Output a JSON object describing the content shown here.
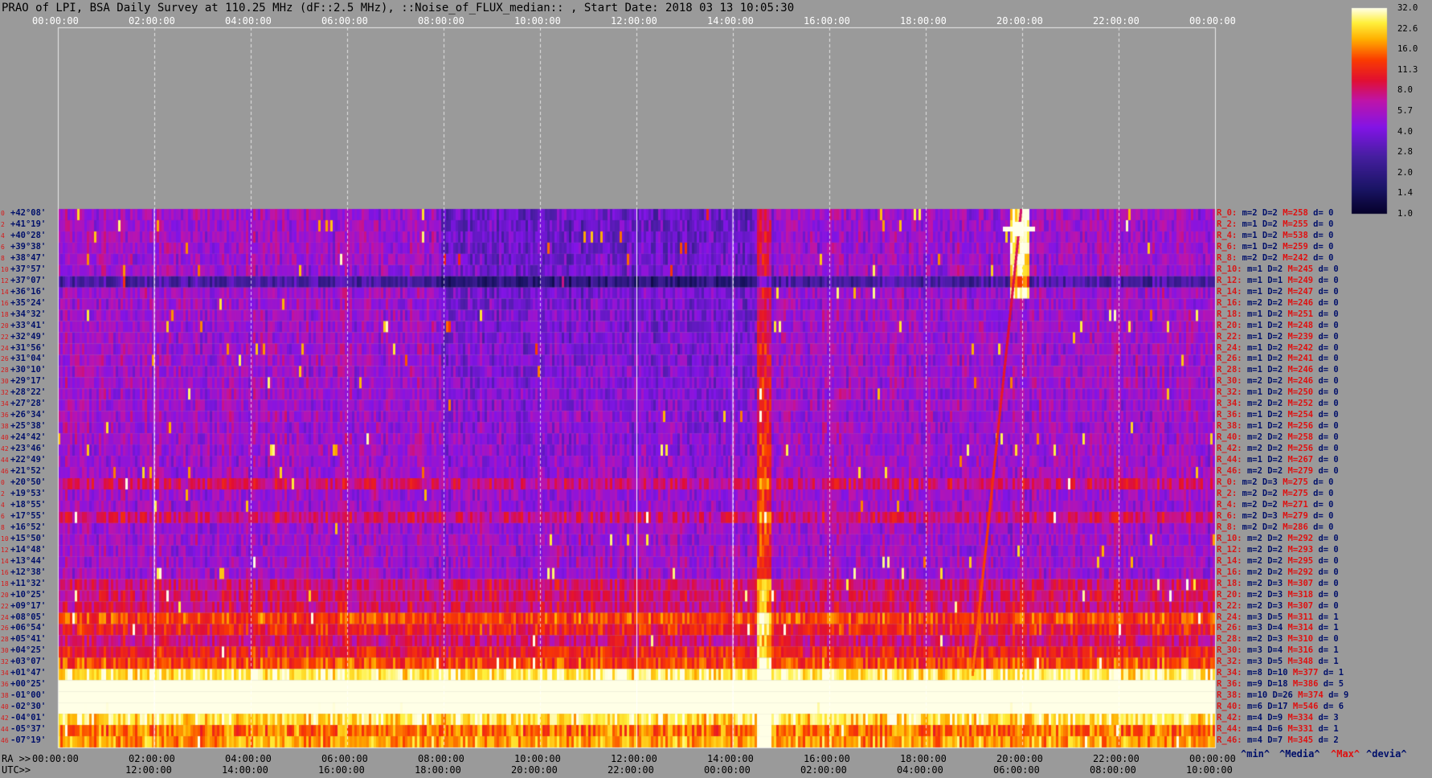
{
  "title": "PRAO of LPI, BSA Daily Survey at 110.25 MHz (dF::2.5 MHz), ::Noise_of_FLUX_median:: , Start Date: 2018 03 13 10:05:30",
  "top_axis": [
    "00:00:00",
    "02:00:00",
    "04:00:00",
    "06:00:00",
    "08:00:00",
    "10:00:00",
    "12:00:00",
    "14:00:00",
    "16:00:00",
    "18:00:00",
    "20:00:00",
    "22:00:00",
    "00:00:00"
  ],
  "bottom": {
    "ra_prefix": "RA >>",
    "ra_ticks": [
      "00:00:00",
      "02:00:00",
      "04:00:00",
      "06:00:00",
      "08:00:00",
      "10:00:00",
      "12:00:00",
      "14:00:00",
      "16:00:00",
      "18:00:00",
      "20:00:00",
      "22:00:00",
      "00:00:00"
    ],
    "utc_prefix": "UTC>>",
    "utc_ticks": [
      "12:00:00",
      "14:00:00",
      "16:00:00",
      "18:00:00",
      "20:00:00",
      "22:00:00",
      "00:00:00",
      "02:00:00",
      "04:00:00",
      "06:00:00",
      "08:00:00",
      "10:00:00"
    ],
    "legend": [
      "^min^",
      "^Media^",
      "^Max^",
      "^devia^"
    ]
  },
  "colorbar": {
    "ticks": [
      "32.0",
      "22.6",
      "16.0",
      "11.3",
      "8.0",
      "5.7",
      "4.0",
      "2.8",
      "2.0",
      "1.4",
      "1.0"
    ]
  },
  "colors": {
    "background": "#9a9a9a",
    "row_label_red": "#d81818",
    "row_label_blue": "#00106a"
  },
  "chart_data": {
    "type": "heatmap",
    "title": "PRAO of LPI, BSA Daily Survey at 110.25 MHz (dF::2.5 MHz), ::Noise_of_FLUX_median:: , Start Date: 2018 03 13 10:05:30",
    "x_axis_top": "RA 00:00:00 - 00:00:00",
    "colorscale_range": [
      1.0,
      32.0
    ],
    "scale": "log",
    "rows": [
      {
        "idx": "0",
        "dec": "+42°08'",
        "ch": "R_0:",
        "min": 2,
        "med": 2,
        "max": 258,
        "dev": 0
      },
      {
        "idx": "2",
        "dec": "+41°19'",
        "ch": "R_2:",
        "min": 1,
        "med": 2,
        "max": 255,
        "dev": 0
      },
      {
        "idx": "4",
        "dec": "+40°28'",
        "ch": "R_4:",
        "min": 1,
        "med": 2,
        "max": 538,
        "dev": 0
      },
      {
        "idx": "6",
        "dec": "+39°38'",
        "ch": "R_6:",
        "min": 1,
        "med": 2,
        "max": 259,
        "dev": 0
      },
      {
        "idx": "8",
        "dec": "+38°47'",
        "ch": "R_8:",
        "min": 2,
        "med": 2,
        "max": 242,
        "dev": 0
      },
      {
        "idx": "10",
        "dec": "+37°57'",
        "ch": "R_10:",
        "min": 1,
        "med": 2,
        "max": 245,
        "dev": 0
      },
      {
        "idx": "12",
        "dec": "+37°07'",
        "ch": "R_12:",
        "min": 1,
        "med": 1,
        "max": 249,
        "dev": 0
      },
      {
        "idx": "14",
        "dec": "+36°16'",
        "ch": "R_14:",
        "min": 1,
        "med": 2,
        "max": 247,
        "dev": 0
      },
      {
        "idx": "16",
        "dec": "+35°24'",
        "ch": "R_16:",
        "min": 2,
        "med": 2,
        "max": 246,
        "dev": 0
      },
      {
        "idx": "18",
        "dec": "+34°32'",
        "ch": "R_18:",
        "min": 1,
        "med": 2,
        "max": 251,
        "dev": 0
      },
      {
        "idx": "20",
        "dec": "+33°41'",
        "ch": "R_20:",
        "min": 1,
        "med": 2,
        "max": 248,
        "dev": 0
      },
      {
        "idx": "22",
        "dec": "+32°49'",
        "ch": "R_22:",
        "min": 1,
        "med": 2,
        "max": 239,
        "dev": 0
      },
      {
        "idx": "24",
        "dec": "+31°56'",
        "ch": "R_24:",
        "min": 1,
        "med": 2,
        "max": 242,
        "dev": 0
      },
      {
        "idx": "26",
        "dec": "+31°04'",
        "ch": "R_26:",
        "min": 1,
        "med": 2,
        "max": 241,
        "dev": 0
      },
      {
        "idx": "28",
        "dec": "+30°10'",
        "ch": "R_28:",
        "min": 1,
        "med": 2,
        "max": 246,
        "dev": 0
      },
      {
        "idx": "30",
        "dec": "+29°17'",
        "ch": "R_30:",
        "min": 2,
        "med": 2,
        "max": 246,
        "dev": 0
      },
      {
        "idx": "32",
        "dec": "+28°22'",
        "ch": "R_32:",
        "min": 1,
        "med": 2,
        "max": 250,
        "dev": 0
      },
      {
        "idx": "34",
        "dec": "+27°28'",
        "ch": "R_34:",
        "min": 2,
        "med": 2,
        "max": 252,
        "dev": 0
      },
      {
        "idx": "36",
        "dec": "+26°34'",
        "ch": "R_36:",
        "min": 1,
        "med": 2,
        "max": 254,
        "dev": 0
      },
      {
        "idx": "38",
        "dec": "+25°38'",
        "ch": "R_38:",
        "min": 1,
        "med": 2,
        "max": 256,
        "dev": 0
      },
      {
        "idx": "40",
        "dec": "+24°42'",
        "ch": "R_40:",
        "min": 2,
        "med": 2,
        "max": 258,
        "dev": 0
      },
      {
        "idx": "42",
        "dec": "+23°46'",
        "ch": "R_42:",
        "min": 2,
        "med": 2,
        "max": 256,
        "dev": 0
      },
      {
        "idx": "44",
        "dec": "+22°49'",
        "ch": "R_44:",
        "min": 1,
        "med": 2,
        "max": 267,
        "dev": 0
      },
      {
        "idx": "46",
        "dec": "+21°52'",
        "ch": "R_46:",
        "min": 2,
        "med": 2,
        "max": 279,
        "dev": 0
      },
      {
        "idx": "0",
        "dec": "+20°50'",
        "ch": "R_0:",
        "min": 2,
        "med": 3,
        "max": 275,
        "dev": 0
      },
      {
        "idx": "2",
        "dec": "+19°53'",
        "ch": "R_2:",
        "min": 2,
        "med": 2,
        "max": 275,
        "dev": 0
      },
      {
        "idx": "4",
        "dec": "+18°55'",
        "ch": "R_4:",
        "min": 2,
        "med": 2,
        "max": 271,
        "dev": 0
      },
      {
        "idx": "6",
        "dec": "+17°55'",
        "ch": "R_6:",
        "min": 2,
        "med": 3,
        "max": 279,
        "dev": 0
      },
      {
        "idx": "8",
        "dec": "+16°52'",
        "ch": "R_8:",
        "min": 2,
        "med": 2,
        "max": 286,
        "dev": 0
      },
      {
        "idx": "10",
        "dec": "+15°50'",
        "ch": "R_10:",
        "min": 2,
        "med": 2,
        "max": 292,
        "dev": 0
      },
      {
        "idx": "12",
        "dec": "+14°48'",
        "ch": "R_12:",
        "min": 2,
        "med": 2,
        "max": 293,
        "dev": 0
      },
      {
        "idx": "14",
        "dec": "+13°44'",
        "ch": "R_14:",
        "min": 2,
        "med": 2,
        "max": 295,
        "dev": 0
      },
      {
        "idx": "16",
        "dec": "+12°38'",
        "ch": "R_16:",
        "min": 2,
        "med": 2,
        "max": 292,
        "dev": 0
      },
      {
        "idx": "18",
        "dec": "+11°32'",
        "ch": "R_18:",
        "min": 2,
        "med": 3,
        "max": 307,
        "dev": 0
      },
      {
        "idx": "20",
        "dec": "+10°25'",
        "ch": "R_20:",
        "min": 2,
        "med": 3,
        "max": 318,
        "dev": 0
      },
      {
        "idx": "22",
        "dec": "+09°17'",
        "ch": "R_22:",
        "min": 2,
        "med": 3,
        "max": 307,
        "dev": 0
      },
      {
        "idx": "24",
        "dec": "+08°05'",
        "ch": "R_24:",
        "min": 3,
        "med": 5,
        "max": 311,
        "dev": 1
      },
      {
        "idx": "26",
        "dec": "+06°54'",
        "ch": "R_26:",
        "min": 3,
        "med": 4,
        "max": 314,
        "dev": 1
      },
      {
        "idx": "28",
        "dec": "+05°41'",
        "ch": "R_28:",
        "min": 2,
        "med": 3,
        "max": 310,
        "dev": 0
      },
      {
        "idx": "30",
        "dec": "+04°25'",
        "ch": "R_30:",
        "min": 3,
        "med": 4,
        "max": 316,
        "dev": 1
      },
      {
        "idx": "32",
        "dec": "+03°07'",
        "ch": "R_32:",
        "min": 3,
        "med": 5,
        "max": 348,
        "dev": 1
      },
      {
        "idx": "34",
        "dec": "+01°47'",
        "ch": "R_34:",
        "min": 8,
        "med": 10,
        "max": 377,
        "dev": 1
      },
      {
        "idx": "36",
        "dec": "+00°25'",
        "ch": "R_36:",
        "min": 9,
        "med": 18,
        "max": 386,
        "dev": 5
      },
      {
        "idx": "38",
        "dec": "-01°00'",
        "ch": "R_38:",
        "min": 10,
        "med": 26,
        "max": 374,
        "dev": 9
      },
      {
        "idx": "40",
        "dec": "-02°30'",
        "ch": "R_40:",
        "min": 6,
        "med": 17,
        "max": 546,
        "dev": 6
      },
      {
        "idx": "42",
        "dec": "-04°01'",
        "ch": "R_42:",
        "min": 4,
        "med": 9,
        "max": 334,
        "dev": 3
      },
      {
        "idx": "44",
        "dec": "-05°37'",
        "ch": "R_44:",
        "min": 4,
        "med": 6,
        "max": 331,
        "dev": 1
      },
      {
        "idx": "46",
        "dec": "-07°19'",
        "ch": "R_46:",
        "min": 4,
        "med": 7,
        "max": 345,
        "dev": 2
      }
    ]
  }
}
